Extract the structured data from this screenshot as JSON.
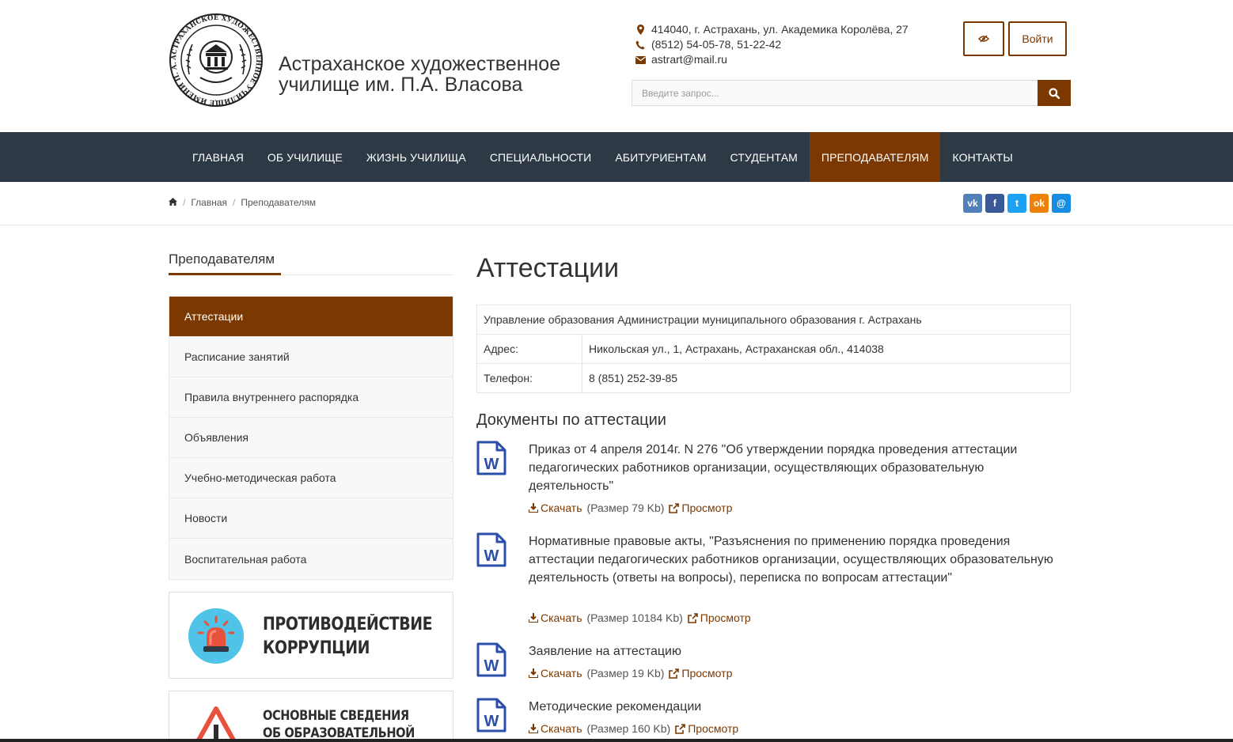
{
  "site": {
    "title_line1": "Астраханское художественное",
    "title_line2": "училище им. П.А. Власова",
    "logo_text": "АСТРАХАНСКОЕ ХУДОЖЕСТВЕННОЕ УЧИЛИЩЕ ИМЕНИ П. А. ВЛАСОВА"
  },
  "contacts": {
    "address": "414040, г. Астрахань, ул. Академика Королёва, 27",
    "phone": "(8512) 54-05-78, 51-22-42",
    "email": "astrart@mail.ru"
  },
  "header": {
    "login_label": "Войти",
    "search_placeholder": "Введите запрос..."
  },
  "nav": {
    "items": [
      {
        "label": "ГЛАВНАЯ"
      },
      {
        "label": "ОБ УЧИЛИЩЕ"
      },
      {
        "label": "ЖИЗНЬ УЧИЛИЩА"
      },
      {
        "label": "СПЕЦИАЛЬНОСТИ"
      },
      {
        "label": "АБИТУРИЕНТАМ"
      },
      {
        "label": "СТУДЕНТАМ"
      },
      {
        "label": "ПРЕПОДАВАТЕЛЯМ",
        "active": true
      },
      {
        "label": "КОНТАКТЫ"
      }
    ]
  },
  "breadcrumb": {
    "home": "Главная",
    "current": "Преподавателям"
  },
  "social": [
    {
      "icon": "vk-icon",
      "glyph": "vk",
      "color": "#5181b8"
    },
    {
      "icon": "facebook-icon",
      "glyph": "f",
      "color": "#3b5998"
    },
    {
      "icon": "twitter-icon",
      "glyph": "t",
      "color": "#1da1f2"
    },
    {
      "icon": "odnoklassniki-icon",
      "glyph": "ok",
      "color": "#ee8208"
    },
    {
      "icon": "moimir-icon",
      "glyph": "@",
      "color": "#168de2"
    }
  ],
  "sidebar": {
    "title": "Преподавателям",
    "items": [
      {
        "label": "Аттестации",
        "active": true
      },
      {
        "label": "Расписание занятий"
      },
      {
        "label": "Правила внутреннего распорядка"
      },
      {
        "label": "Объявления"
      },
      {
        "label": "Учебно-методическая работа"
      },
      {
        "label": "Новости"
      },
      {
        "label": "Воспитательная работа"
      }
    ],
    "banner1_line1": "ПРОТИВОДЕЙСТВИЕ",
    "banner1_line2": "КОРРУПЦИИ",
    "banner2_line1": "ОСНОВНЫЕ СВЕДЕНИЯ",
    "banner2_line2": "ОБ ОБРАЗОВАТЕЛЬНОЙ"
  },
  "main": {
    "title": "Аттестации",
    "org_name": "Управление образования Администрации муниципального образования г. Астрахань",
    "address_label": "Адрес:",
    "address_value": "Никольская ул., 1, Астрахань, Астраханская обл., 414038",
    "phone_label": "Телефон:",
    "phone_value": "8 (851) 252-39-85",
    "docs_title": "Документы по аттестации",
    "download_label": "Скачать",
    "view_label": "Просмотр",
    "documents": [
      {
        "title": "Приказ от 4 апреля 2014г. N 276 \"Об утверждении порядка проведения аттестации педагогических работников организации, осуществляющих образовательную деятельность\"",
        "size": "(Размер 79 Kb)"
      },
      {
        "title": "Нормативные правовые акты, \"Разъяснения по применению порядка проведения аттестации педагогических работников организации, осуществляющих образовательную деятельность (ответы на вопросы), переписка по вопросам аттестации\"",
        "size": "(Размер 10184 Kb)"
      },
      {
        "title": "Заявление на аттестацию",
        "size": "(Размер 19 Kb)"
      },
      {
        "title": "Методические рекомендации",
        "size": "(Размер 160 Kb)"
      }
    ]
  },
  "colors": {
    "accent": "#7b3800",
    "nav_bg": "#2d3a46"
  }
}
